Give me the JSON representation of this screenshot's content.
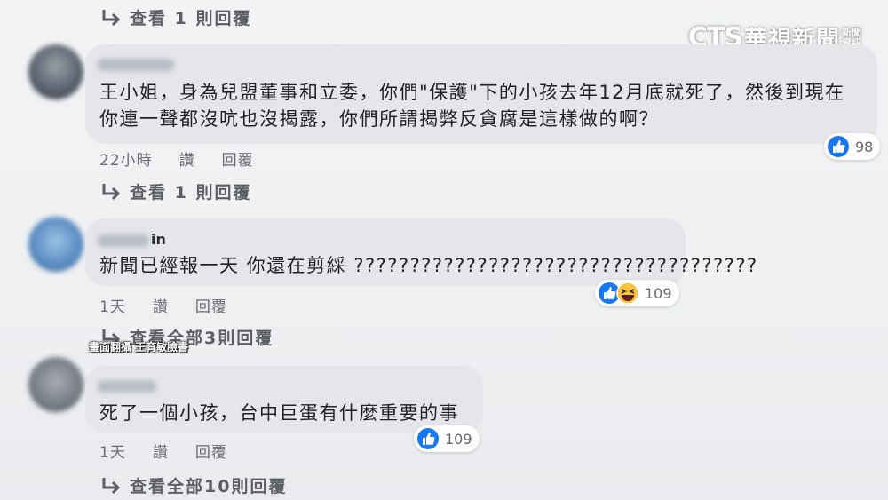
{
  "broadcaster": {
    "logo_main": "CTS",
    "logo_name": "華視新聞",
    "logo_side_top": "新聞",
    "logo_side_bottom": "資訊"
  },
  "caption": "畫面翻攝 王育敏臉書",
  "comments": [
    {
      "view_replies_above": "查看 1 則回覆",
      "name_tail": "",
      "text_line1": "王小姐，身為兒盟董事和立委，你們\"保護\"下的小孩去年12月底就死了，然後到現在",
      "text_line2": "你連一聲都沒吭也沒揭露，你們所謂揭弊反貪腐是這樣做的啊？",
      "time": "22小時",
      "like": "讚",
      "reply": "回覆",
      "reaction_count": "98",
      "view_replies": "查看 1 則回覆"
    },
    {
      "name_tail": "in",
      "text_line1": "新聞已經報一天 你還在剪綵 ????????????????????????????????????",
      "time": "1天",
      "like": "讚",
      "reply": "回覆",
      "reaction_count": "109",
      "view_replies": "查看全部3則回覆"
    },
    {
      "name_tail": "",
      "text_line1": "死了一個小孩，台中巨蛋有什麼重要的事",
      "time": "1天",
      "like": "讚",
      "reply": "回覆",
      "reaction_count": "109",
      "view_replies": "查看全部10則回覆"
    }
  ],
  "colors": {
    "like_blue": "#1877f2",
    "bubble": "#e4e6ea",
    "haha_yellow": "#f7c23c"
  }
}
